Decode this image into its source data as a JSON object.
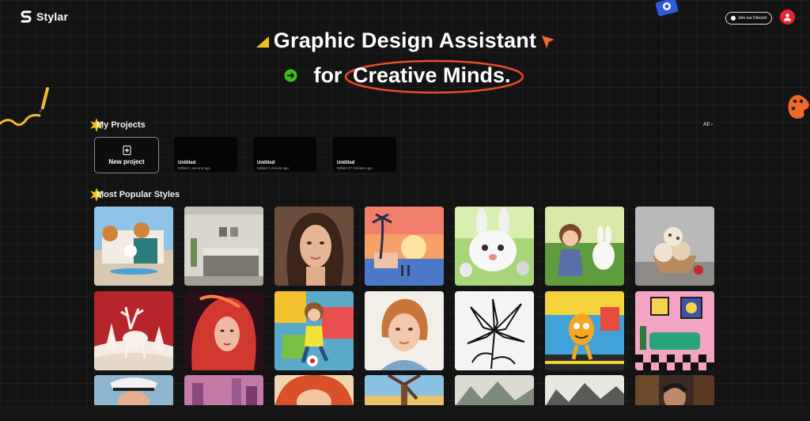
{
  "app": {
    "name": "Stylar"
  },
  "header": {
    "discord_label": "Join our Discord",
    "discord_icon": "discord-icon",
    "avatar_icon": "user-icon"
  },
  "hero": {
    "line1": "Graphic Design Assistant",
    "line2_prefix": "for",
    "line2_highlight": "Creative Minds.",
    "accent_color": "#e84b2a"
  },
  "projects": {
    "title": "My Projects",
    "all_label": "All ›",
    "new_project_label": "New project",
    "items": [
      {
        "title": "Untitled",
        "subtitle": "Edited 1 second ago"
      },
      {
        "title": "Untitled",
        "subtitle": "Edited 1 minute ago"
      },
      {
        "title": "Untitled",
        "subtitle": "Edited 27 minutes ago"
      }
    ]
  },
  "styles": {
    "title": "Most Popular Styles",
    "tiles": [
      "3d-architecture",
      "interior-bedroom",
      "portrait-photo",
      "retro-sunset",
      "cute-bunny-3d",
      "girl-and-bunny",
      "ice-cream-dessert",
      "papercut-deer",
      "neon-portrait",
      "graffiti-girl",
      "watercolor-child",
      "lily-line-art",
      "cartoon-character",
      "pink-room",
      "sailor-portrait",
      "pink-city",
      "redhead-comic",
      "windmill",
      "landscape-chinese",
      "ink-mountains",
      "man-portrait"
    ]
  }
}
